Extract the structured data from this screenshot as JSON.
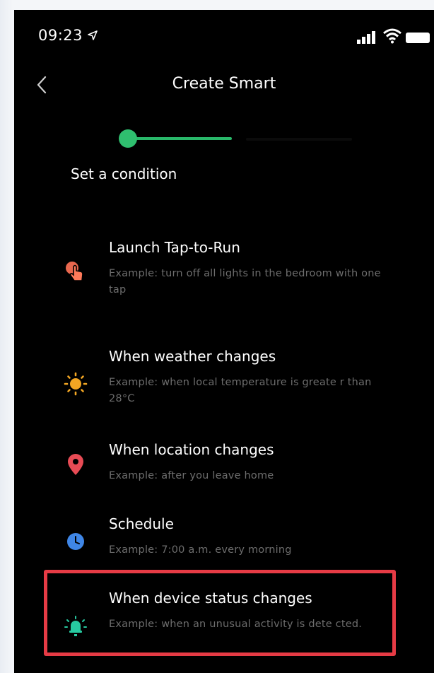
{
  "status_bar": {
    "time": "09:23"
  },
  "nav": {
    "title": "Create Smart"
  },
  "progress": {
    "step": 1,
    "total_steps": 2
  },
  "section_title": "Set a condition",
  "conditions": [
    {
      "title": "Launch Tap-to-Run",
      "description": "Example: turn off all lights in the bedroom with one tap",
      "icon": "tap-icon",
      "color": "#e8674e"
    },
    {
      "title": "When weather changes",
      "description": "Example: when local temperature is greate r than 28°C",
      "icon": "sun-icon",
      "color": "#f3a623"
    },
    {
      "title": "When location changes",
      "description": "Example: after you leave home",
      "icon": "location-pin-icon",
      "color": "#e84b55"
    },
    {
      "title": "Schedule",
      "description": "Example: 7:00 a.m. every morning",
      "icon": "clock-icon",
      "color": "#3f86e6"
    },
    {
      "title": "When device status changes",
      "description": "Example: when an unusual activity is dete cted.",
      "icon": "bulb-icon",
      "color": "#27c9a0"
    }
  ],
  "highlight": {
    "color": "#e63b45",
    "target": "When device status changes"
  }
}
